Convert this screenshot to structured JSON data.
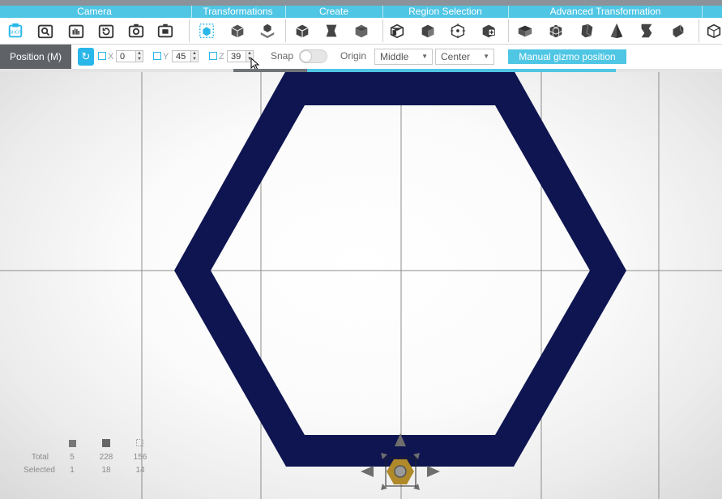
{
  "categories": [
    "Camera",
    "Transformations",
    "Create",
    "Region Selection",
    "Advanced Transformation"
  ],
  "icons": {
    "camera": [
      "screenshot-icon",
      "zoom-selection-icon",
      "pan-camera-icon",
      "rotate-camera-icon",
      "camera-icon",
      "camera-focus-icon"
    ],
    "transformations": [
      "move-selection-icon",
      "transform-cube-icon",
      "scale-object-icon"
    ],
    "create": [
      "create-cube-icon",
      "create-shape-icon",
      "create-box-icon"
    ],
    "region_selection": [
      "box-select-icon",
      "face-select-icon",
      "vertex-select-icon",
      "add-select-icon"
    ],
    "advanced": [
      "bevel-icon",
      "subdivide-icon",
      "extrude-icon",
      "pyramid-icon",
      "twist-icon",
      "smooth-icon",
      "bridge-icon"
    ]
  },
  "position_bar": {
    "mode_label": "Position (M)",
    "reset_glyph": "↻",
    "x_label": "X",
    "x_value": "0",
    "y_label": "Y",
    "y_value": "45",
    "z_label": "Z",
    "z_value": "39",
    "snap_label": "Snap",
    "snap_on": false,
    "origin_label": "Origin",
    "origin_value": "Middle",
    "align_value": "Center",
    "manual_gizmo_label": "Manual gizmo position"
  },
  "stats": {
    "total_label": "Total",
    "selected_label": "Selected",
    "total": [
      "5",
      "228",
      "156"
    ],
    "selected": [
      "1",
      "18",
      "14"
    ]
  },
  "colors": {
    "accent": "#4fc6e4",
    "hexagon": "#0e1550",
    "gizmo": "#b08a2a"
  }
}
